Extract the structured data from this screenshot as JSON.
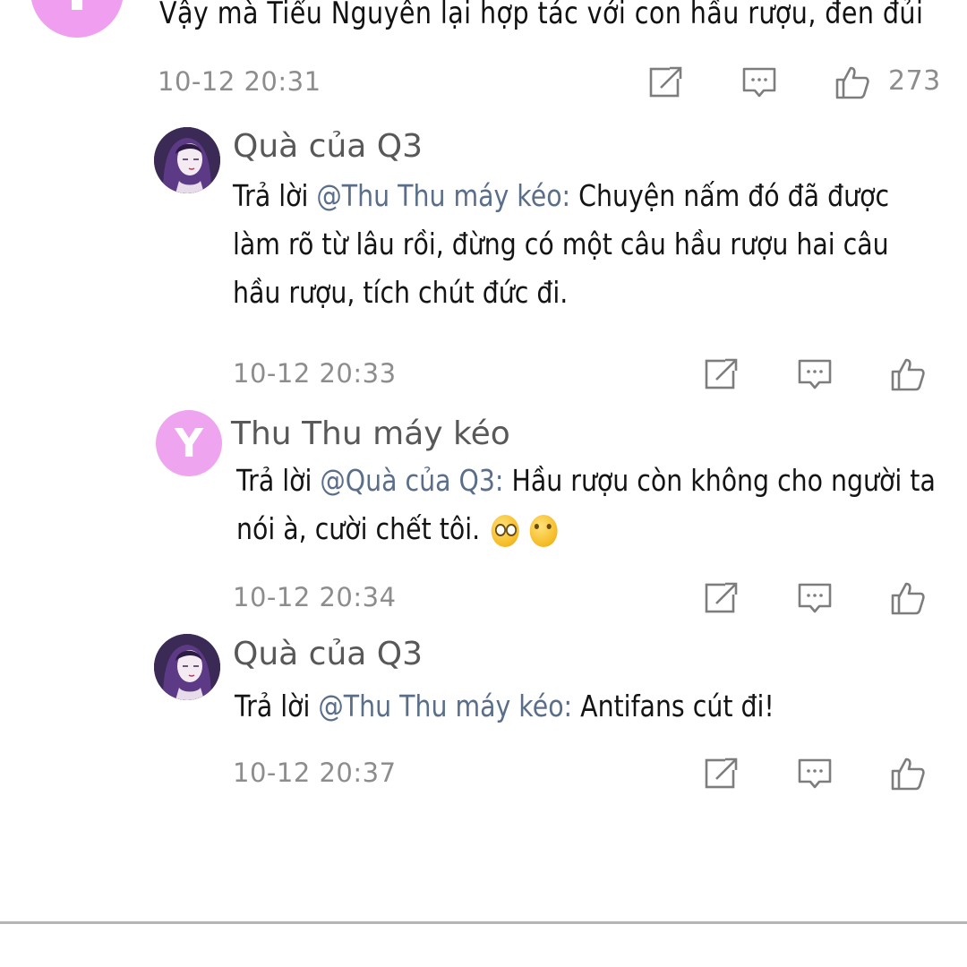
{
  "top_comment": {
    "avatar_letter": "Y",
    "text": "Vậy mà Tiểu Nguyên lại hợp tác với con hầu rượu, đen đủi",
    "timestamp": "10-12 20:31",
    "like_count": "273"
  },
  "replies": [
    {
      "username": "Quà của Q3",
      "reply_prefix": "Trả lời",
      "mention": "@Thu Thu máy kéo:",
      "text": "Chuyện nấm đó đã được làm rõ từ lâu rồi, đừng có một câu hầu rượu hai câu hầu rượu, tích chút đức đi.",
      "timestamp": "10-12 20:33"
    },
    {
      "username": "Thu Thu máy kéo",
      "avatar_letter": "Y",
      "reply_prefix": "Trả lời",
      "mention": "@Quà của Q3:",
      "text": "Hầu rượu còn không cho người ta nói à, cười chết tôi.",
      "timestamp": "10-12 20:34"
    },
    {
      "username": "Quà của Q3",
      "reply_prefix": "Trả lời",
      "mention": "@Thu Thu máy kéo:",
      "text": "Antifans cút đi!",
      "timestamp": "10-12 20:37"
    }
  ],
  "icons": {
    "share": "share-icon",
    "comment": "comment-icon",
    "like": "thumbs-up-icon"
  },
  "colors": {
    "avatar_pink": "#efa4f0",
    "mention_blue": "#5a6e8a",
    "meta_gray": "#8d8d8d"
  }
}
